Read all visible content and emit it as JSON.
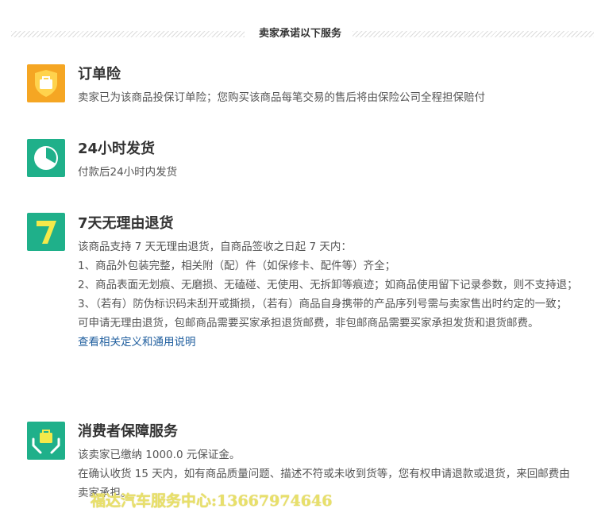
{
  "header": {
    "title": "卖家承诺以下服务"
  },
  "services": {
    "insurance": {
      "title": "订单险",
      "desc": "卖家已为该商品投保订单险；您购买该商品每笔交易的售后将由保险公司全程担保赔付",
      "icon": "shield-bag-icon",
      "color": "#f5a623"
    },
    "shipping": {
      "title": "24小时发货",
      "desc": "付款后24小时内发货",
      "icon": "clock-pie-icon",
      "color": "#1fb08a"
    },
    "returns": {
      "title": "7天无理由退货",
      "lines": [
        "该商品支持 7 天无理由退货，自商品签收之日起 7 天内：",
        "1、商品外包装完整，相关附（配）件（如保修卡、配件等）齐全；",
        "2、商品表面无划痕、无磨损、无磕碰、无使用、无拆卸等痕迹；如商品使用留下记录参数，则不支持退；",
        "3、（若有）防伪标识码未刮开或撕损，（若有）商品自身携带的产品序列号需与卖家售出时约定的一致；",
        "可申请无理由退货，包邮商品需要买家承担退货邮费，非包邮商品需要买家承担发货和退货邮费。"
      ],
      "link": "查看相关定义和通用说明",
      "icon": "seven-icon",
      "color": "#1fb08a"
    },
    "guarantee": {
      "title": "消费者保障服务",
      "lines": [
        "该卖家已缴纳 1000.0 元保证金。",
        "在确认收货 15 天内，如有商品质量问题、描述不符或未收到货等，您有权申请退款或退货，来回邮费由卖家承担。"
      ],
      "icon": "hands-bag-icon",
      "color": "#1fb08a"
    }
  },
  "watermark": "福达汽车服务中心:13667974646"
}
